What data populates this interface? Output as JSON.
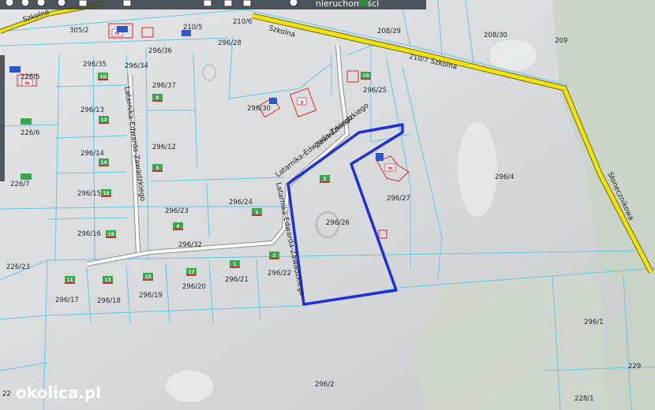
{
  "streets": {
    "szkolna_a": "Szkolna",
    "szkolna_b": "Szkolna",
    "szkolna_c": "210/7",
    "szkolna_d": "Szkolna",
    "slonecznikowa": "Słonecznikowa",
    "zawadzkiego_1": "Latarnika-Edwarda-Zawadzkiego",
    "zawadzkiego_2": "Latarnika-Edwarda-Zawadzkiego",
    "zawadzkiego_3": "Latarnika-Edwarda-Zawadzkiego",
    "zawadzkiego_4": "Zawadzkiego"
  },
  "parcels": [
    "305/2",
    "210/5",
    "210/6",
    "208/29",
    "208/30",
    "209",
    "296/35",
    "296/34",
    "296/36",
    "296/28",
    "226/5",
    "296/37",
    "296/13",
    "296/30",
    "296/25",
    "226/6",
    "296/12",
    "296/14",
    "296/4",
    "296/27",
    "226/7",
    "296/15",
    "296/23",
    "296/24",
    "296/26",
    "296/16",
    "296/32",
    "226/23",
    "296/17",
    "296/18",
    "296/19",
    "296/20",
    "296/21",
    "296/22",
    "296/1",
    "229",
    "296/2",
    "228/1",
    "22"
  ],
  "building_numbers": [
    "10",
    "8",
    "12",
    "14",
    "6",
    "16",
    "18",
    "4",
    "2",
    "5",
    "3",
    "1",
    "11",
    "13",
    "15",
    "17",
    "19",
    "m",
    "m",
    "m",
    "g"
  ],
  "toolbar": {
    "label": "nieruchomości"
  },
  "watermark": "okolica.pl",
  "colors": {
    "selection": "#1f2fe0",
    "road": "#f1e20a",
    "road_edge": "#6d6a1a",
    "parcel_line": "#5fc9e8"
  }
}
